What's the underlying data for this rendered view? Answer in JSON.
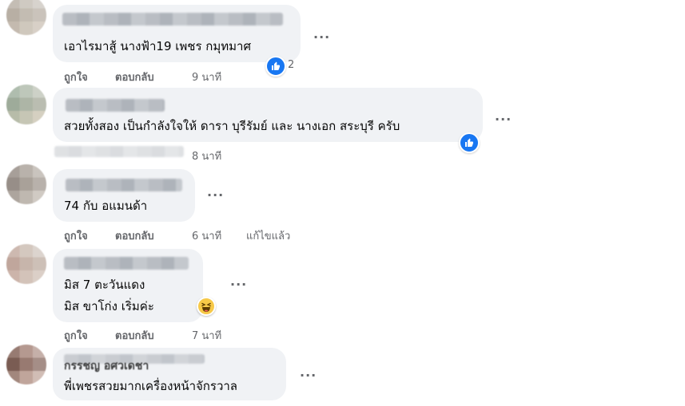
{
  "comments": [
    {
      "text_lines": [
        "เอาไรมาสู้ นางฟ้า19 เพชร กมุทมาศ"
      ],
      "actions": {
        "like": "ถูกใจ",
        "reply": "ตอบกลับ",
        "time": "9 นาที"
      },
      "reaction": {
        "icon": "thumbs-up-icon",
        "count": "2",
        "color": "#1877f2"
      }
    },
    {
      "text_lines": [
        "สวยทั้งสอง เป็นกำลังใจให้ ดารา บุรีรัมย์ และ นางเอก สระบุรี ครับ"
      ],
      "actions": {
        "time": "8 นาที"
      },
      "reaction": {
        "icon": "thumbs-up-icon",
        "color": "#1877f2"
      }
    },
    {
      "text_lines": [
        "74 กับ อแมนด้า"
      ],
      "actions": {
        "like": "ถูกใจ",
        "reply": "ตอบกลับ",
        "time": "6 นาที",
        "edited": "แก้ไขแล้ว"
      }
    },
    {
      "text_lines": [
        "มิส 7 ตะวันแดง",
        "มิส ขาโก่ง เริ่มค่ะ"
      ],
      "actions": {
        "like": "ถูกใจ",
        "reply": "ตอบกลับ",
        "time": "7 นาที"
      },
      "reaction": {
        "icon": "haha-icon",
        "color": "#f7c948"
      }
    },
    {
      "author": "กรรชญ อศวเดชา",
      "text_lines": [
        "พี่เพชรสวยมากเครื่องหน้าจักรวาล"
      ]
    }
  ],
  "more_label": "..."
}
